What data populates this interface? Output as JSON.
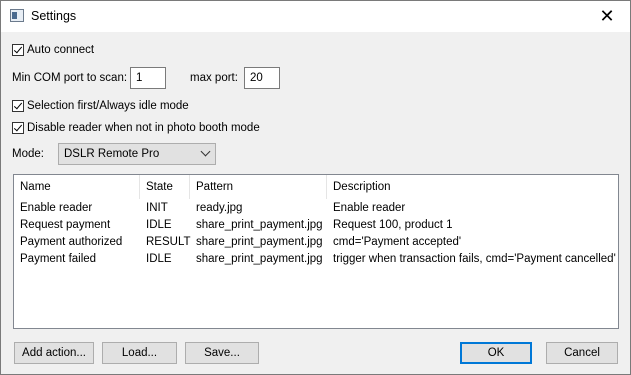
{
  "window": {
    "title": "Settings",
    "close_glyph": "✕"
  },
  "options": {
    "auto_connect": {
      "label": "Auto connect",
      "checked": true
    },
    "min_com_label": "Min COM port to scan:",
    "min_com_value": "1",
    "max_port_label": "max port:",
    "max_port_value": "20",
    "selection_first": {
      "label": "Selection first/Always idle mode",
      "checked": true
    },
    "disable_reader": {
      "label": "Disable reader when not in photo booth mode",
      "checked": true
    },
    "mode_label": "Mode:",
    "mode_value": "DSLR Remote Pro"
  },
  "table": {
    "columns": [
      "Name",
      "State",
      "Pattern",
      "Description"
    ],
    "rows": [
      [
        "Enable reader",
        "INIT",
        "ready.jpg",
        "Enable reader"
      ],
      [
        "Request payment",
        "IDLE",
        "share_print_payment.jpg",
        "Request 100, product 1"
      ],
      [
        "Payment authorized",
        "RESULT",
        "share_print_payment.jpg",
        "cmd='Payment accepted'"
      ],
      [
        "Payment failed",
        "IDLE",
        "share_print_payment.jpg",
        "trigger when transaction fails, cmd='Payment cancelled'"
      ]
    ]
  },
  "buttons": {
    "add_action": "Add action...",
    "load": "Load...",
    "save": "Save...",
    "ok": "OK",
    "cancel": "Cancel"
  },
  "icons": {
    "app": "settings-app-icon",
    "close": "close-icon",
    "check": "checkmark-icon",
    "dropdown": "chevron-down-icon"
  },
  "colors": {
    "accent": "#0078d7",
    "background": "#f0f0f0"
  }
}
